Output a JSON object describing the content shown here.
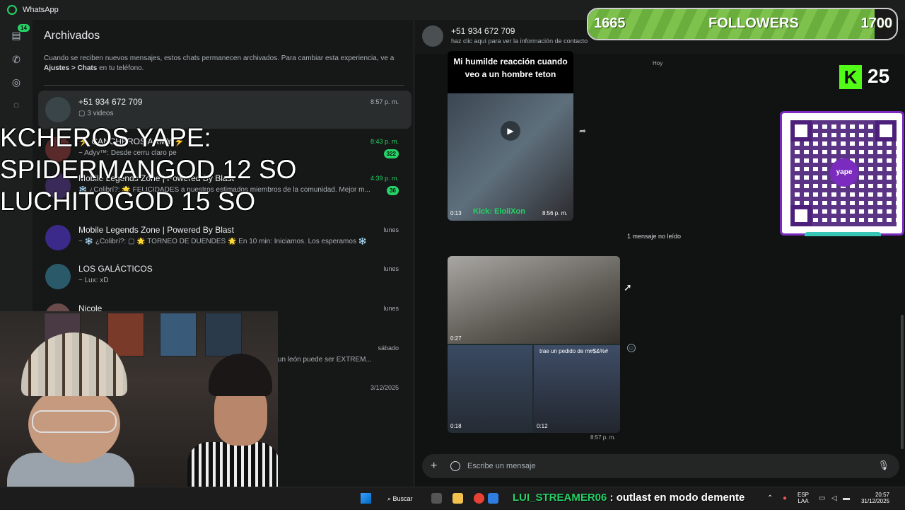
{
  "app": {
    "title": "WhatsApp"
  },
  "rail": {
    "badge": "14"
  },
  "archived": {
    "title": "Archivados",
    "desc_part1": "Cuando se reciben nuevos mensajes, estos chats permanecen archivados. Para cambiar esta experiencia, ve a ",
    "desc_bold": "Ajustes > Chats",
    "desc_part2": " en tu teléfono.",
    "chats": [
      {
        "name": "+51 934 672 709",
        "preview": "▢ 3 videos",
        "time": "8:57 p. m."
      },
      {
        "name": "⚡ CANCHEROS ARMY ⚡",
        "preview": "~ Adyv™: Desde cerru claro pe",
        "time": "8:43 p. m.",
        "count": "322"
      },
      {
        "name": "Mobile Legends Zone | Powered By Blast",
        "preview": "❄️ ¿Colibrí?: 🌟 FELICIDADES a nuestros estimados miembros de la comunidad. Mejor m...",
        "time": "4:39 p. m.",
        "count": "36"
      },
      {
        "name": "Mobile Legends Zone | Powered By Blast",
        "preview": "~ ❄️ ¿Colibrí?: ▢ 🌟 TORNEO DE DUENDES 🌟  En 10 min: Iniciamos.  Los esperamos ❄️",
        "time": "lunes"
      },
      {
        "name": "LOS GALÁCTICOS",
        "preview": "~ Lux: xD",
        "time": "lunes"
      },
      {
        "name": "Nicole",
        "preview": "",
        "time": "lunes"
      },
      {
        "name": "",
        "preview": "n tigre o un león puede ser EXTREM...",
        "time": "sábado"
      },
      {
        "name": "",
        "preview": "",
        "time": "3/12/2025"
      }
    ]
  },
  "overlay": {
    "text": "KCHEROS YAPE:\nSPIDERMANGOD 12 SO\nLUCHITOGOD 15 SO"
  },
  "conversation": {
    "name": "+51 934 672 709",
    "subtitle": "haz clic aquí para ver la información de contacto",
    "day": "Hoy",
    "msg1_caption": "Mi humilde reacción cuando veo a un hombre teton",
    "msg1_overlay": "Kick: EloliXon",
    "msg1_duration": "0:13",
    "msg1_time": "8:56 p. m.",
    "unread": "1 mensaje no leído",
    "msg2_dur_big": "0:27",
    "msg2_dur_sm1": "0:18",
    "msg2_dur_sm2": "0:12",
    "msg2_caption": "trae un pedido de m#$&%#",
    "msg2_time": "8:57 p. m.",
    "compose_placeholder": "Escribe un mensaje"
  },
  "followers": {
    "current": "1665",
    "label": "FOLLOWERS",
    "goal": "1700",
    "progress": 0.93
  },
  "kick": {
    "viewers": "25"
  },
  "yape": {
    "logo": "yape"
  },
  "taskbar": {
    "search": "Buscar",
    "ticker_nick": "LUI_STREAMER06",
    "ticker_msg": " : outlast en modo demente",
    "lang1": "ESP",
    "lang2": "LAA",
    "time": "20:57",
    "date": "31/12/2025"
  },
  "colors": {
    "accent": "#25d366",
    "kick": "#53fc18",
    "yape": "#7b2cbf"
  }
}
